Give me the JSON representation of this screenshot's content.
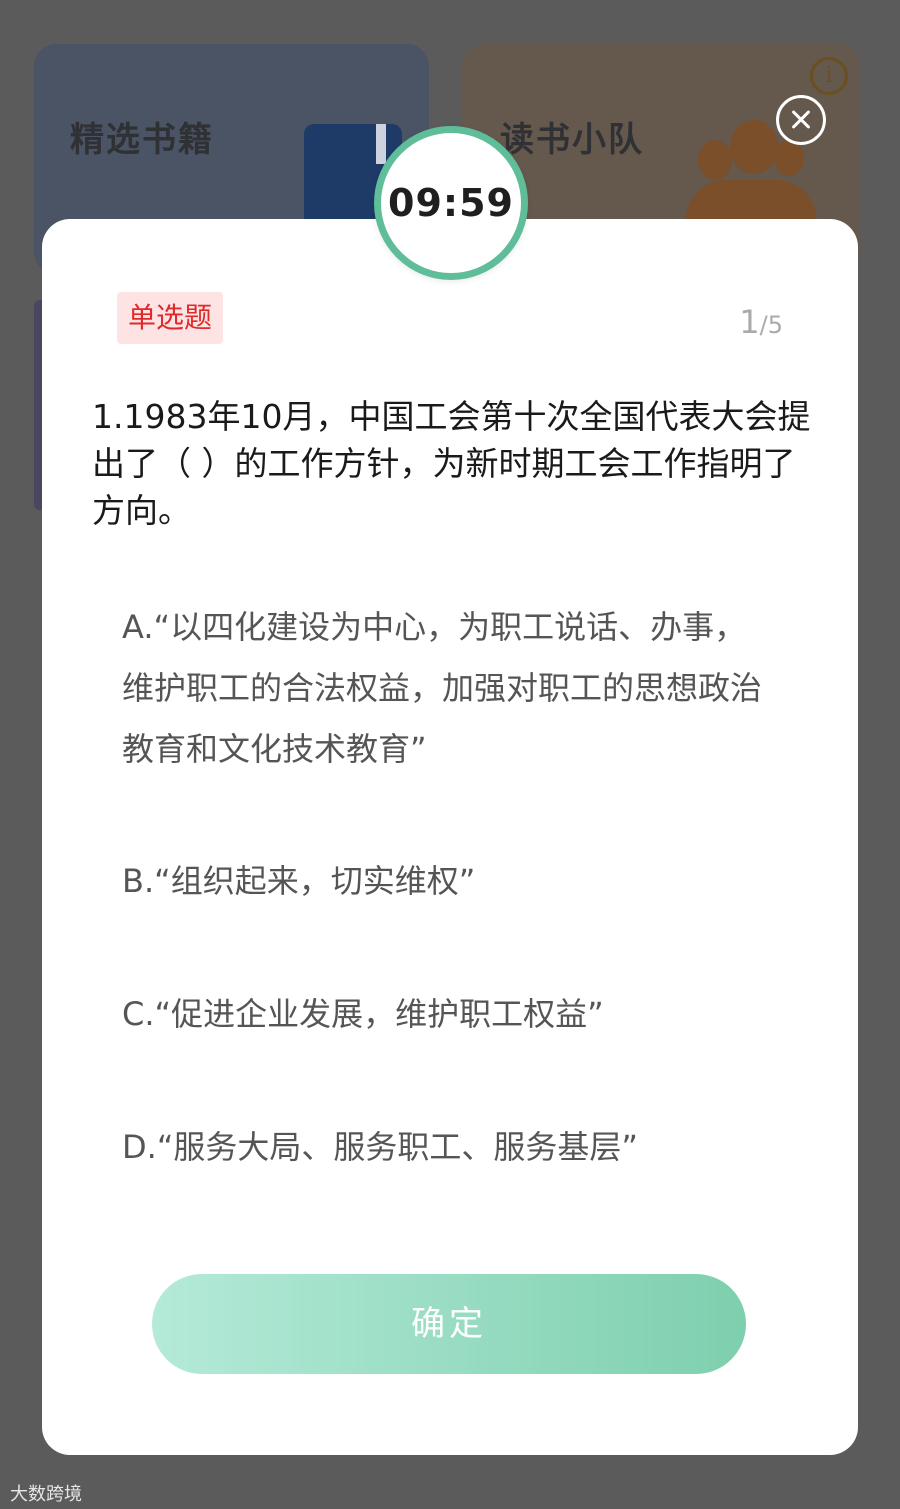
{
  "background": {
    "card_books_title": "精选书籍",
    "card_team_title": "读书小队"
  },
  "timer": "09:59",
  "question": {
    "type_label": "单选题",
    "progress_current": "1",
    "progress_total": "/5",
    "text": "1.1983年10月，中国工会第十次全国代表大会提出了（ ）的工作方针，为新时期工会工作指明了方向。"
  },
  "options": [
    {
      "text": "A.“以四化建设为中心，为职工说话、办事，维护职工的合法权益，加强对职工的思想政治教育和文化技术教育”"
    },
    {
      "text": "B.“组织起来，切实维权”"
    },
    {
      "text": "C.“促进企业发展，维护职工权益”"
    },
    {
      "text": "D.“服务大局、服务职工、服务基层”"
    }
  ],
  "confirm_label": "确定",
  "watermark": "大数跨境",
  "colors": {
    "accent": "#5fbd9a",
    "tag_bg": "#fde3e3",
    "tag_text": "#e0292c"
  },
  "icons": [
    "info-icon",
    "close-icon"
  ]
}
